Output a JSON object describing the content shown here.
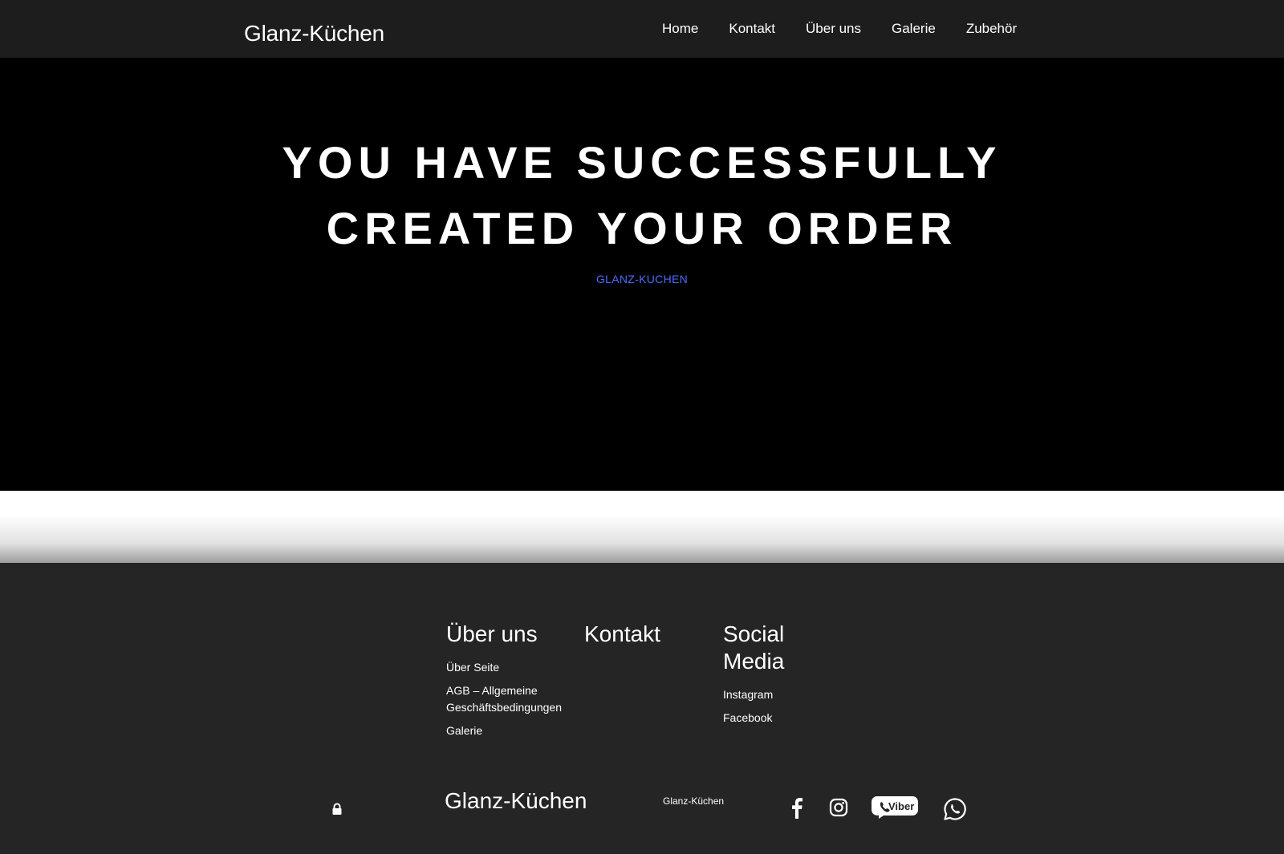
{
  "header": {
    "brand": "Glanz-Küchen",
    "nav": [
      "Home",
      "Kontakt",
      "Über uns",
      "Galerie",
      "Zubehör"
    ]
  },
  "hero": {
    "title_line1": "YOU HAVE SUCCESSFULLY",
    "title_line2": "CREATED YOUR ORDER",
    "link": "GLANZ-KUCHEN"
  },
  "footer": {
    "about": {
      "heading": "Über uns",
      "items": [
        "Über Seite",
        "AGB – Allgemeine Geschäftsbedingungen",
        "Galerie"
      ]
    },
    "contact": {
      "heading": "Kontakt"
    },
    "social": {
      "heading": "Social Media",
      "items": [
        "Instagram",
        "Facebook"
      ]
    },
    "brand": "Glanz-Küchen",
    "small_brand": "Glanz-Küchen",
    "viber_label": "Viber",
    "icons": [
      "lock-icon",
      "facebook-icon",
      "instagram-icon",
      "viber-icon",
      "whatsapp-icon"
    ]
  },
  "colors": {
    "header_bg": "#1e1d1e",
    "hero_bg": "#000000",
    "footer_bg": "#252525",
    "link_blue": "#4b6bff"
  }
}
